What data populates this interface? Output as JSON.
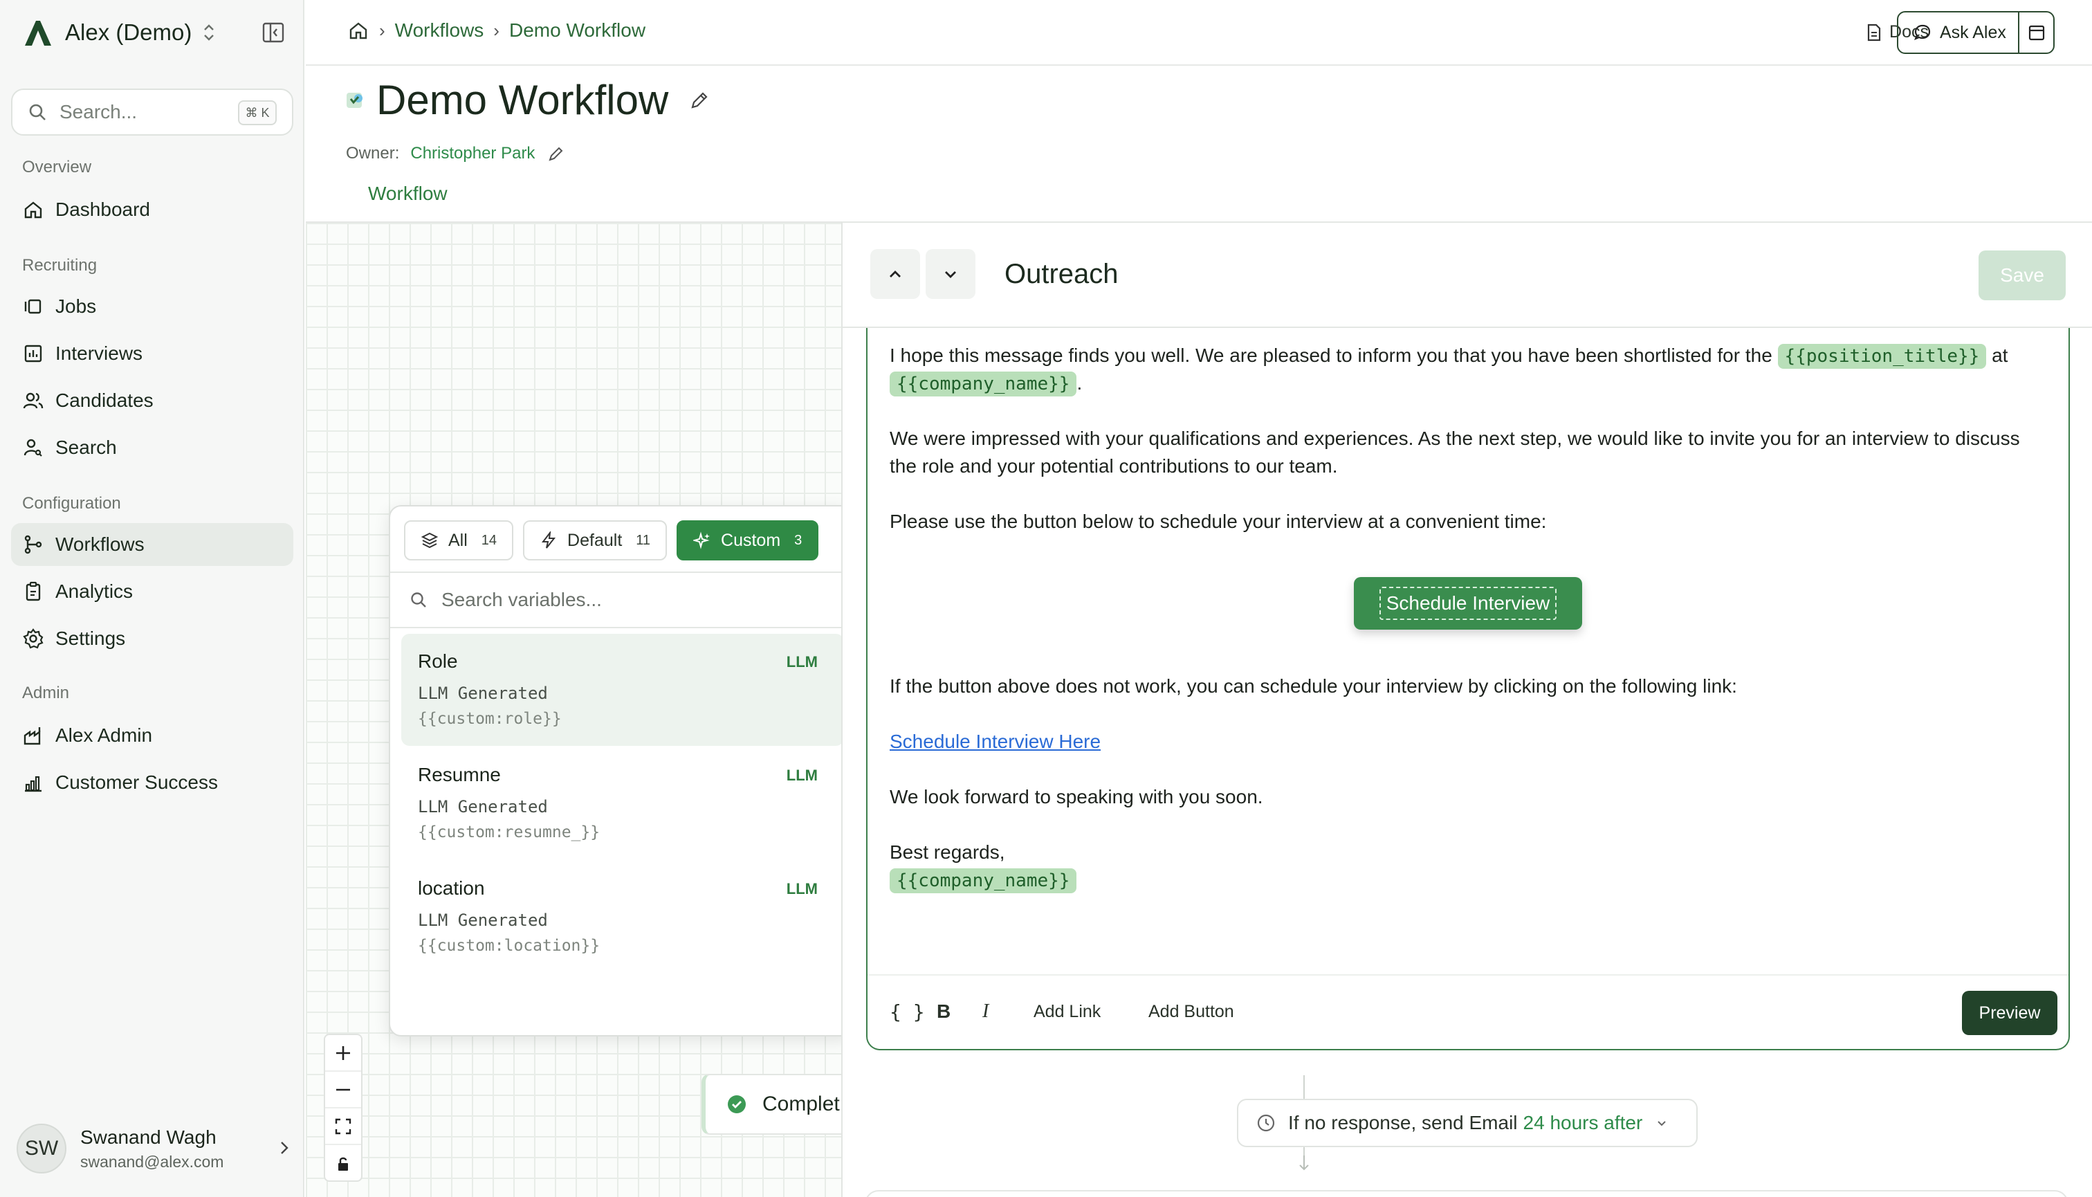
{
  "workspace": {
    "name": "Alex (Demo)"
  },
  "search": {
    "placeholder": "Search...",
    "shortcut": "⌘ K"
  },
  "sidebar": {
    "sections": {
      "overview": "Overview",
      "recruiting": "Recruiting",
      "configuration": "Configuration",
      "admin": "Admin"
    },
    "items": {
      "dashboard": "Dashboard",
      "jobs": "Jobs",
      "interviews": "Interviews",
      "candidates": "Candidates",
      "search": "Search",
      "workflows": "Workflows",
      "analytics": "Analytics",
      "settings": "Settings",
      "alex_admin": "Alex Admin",
      "customer_success": "Customer Success"
    },
    "active": "workflows"
  },
  "user": {
    "initials": "SW",
    "name": "Swanand Wagh",
    "email": "swanand@alex.com"
  },
  "breadcrumb": {
    "section": "Workflows",
    "current": "Demo Workflow"
  },
  "header": {
    "docs": "Docs",
    "ask": "Ask Alex"
  },
  "page": {
    "title": "Demo Workflow",
    "owner_label": "Owner:",
    "owner": "Christopher Park",
    "tab": "Workflow"
  },
  "canvas": {
    "complete_node": "Complet"
  },
  "variables": {
    "tabs": [
      {
        "label": "All",
        "count": "14"
      },
      {
        "label": "Default",
        "count": "11"
      },
      {
        "label": "Custom",
        "count": "3",
        "active": true
      }
    ],
    "search_placeholder": "Search variables...",
    "items": [
      {
        "name": "Role",
        "tag": "LLM",
        "subtitle": "LLM Generated",
        "key": "{{custom:role}}"
      },
      {
        "name": "Resumne",
        "tag": "LLM",
        "subtitle": "LLM Generated",
        "key": "{{custom:resumne_}}"
      },
      {
        "name": "location",
        "tag": "LLM",
        "subtitle": "LLM Generated",
        "key": "{{custom:location}}"
      }
    ]
  },
  "panel": {
    "title": "Outreach",
    "save": "Save",
    "email": {
      "p1_text": "I hope this message finds you well. We are pleased to inform you that you have been shortlisted for the",
      "var_position": "{{position_title}}",
      "p1_at": "at",
      "var_company": "{{company_name}}",
      "p2": "We were impressed with your qualifications and experiences. As the next step, we would like to invite you for an interview to discuss the role and your potential contributions to our team.",
      "p3": "Please use the button below to schedule your interview at a convenient time:",
      "button": "Schedule Interview",
      "p4": "If the button above does not work, you can schedule your interview by clicking on the following link:",
      "link": "Schedule Interview Here",
      "p5": "We look forward to speaking with you soon.",
      "signoff": "Best regards,",
      "var_signature": "{{company_name}}"
    },
    "toolbar": {
      "vars": "{ }",
      "bold": "B",
      "italic": "I",
      "add_link": "Add Link",
      "add_button": "Add Button",
      "preview": "Preview"
    },
    "followup": {
      "text": "If no response, send Email",
      "highlight": "24 hours after"
    }
  },
  "colors": {
    "accent": "#2f8a45",
    "dark_green": "#22432a",
    "variable_bg": "#b9dfb9",
    "link": "#2a6bd6"
  }
}
